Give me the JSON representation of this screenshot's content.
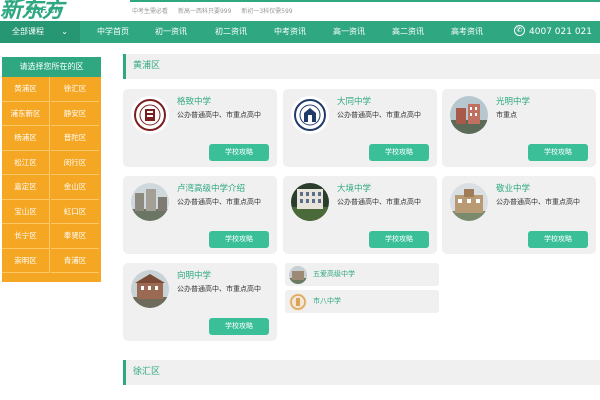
{
  "header": {
    "logo_big": "新东方",
    "logo_small": "XDF.CN",
    "hot_links": [
      "中考生需必看",
      "新高一西科只要999",
      "新初一3科仅需599"
    ]
  },
  "nav": {
    "all_courses": "全部课程",
    "items": [
      "中学首页",
      "初一资讯",
      "初二资讯",
      "中考资讯",
      "高一资讯",
      "高二资讯",
      "高考资讯"
    ],
    "phone": "4007 021 021"
  },
  "sidebar": {
    "title": "请选择您所在的区",
    "districts": [
      "黄浦区",
      "徐汇区",
      "浦东新区",
      "静安区",
      "杨浦区",
      "普陀区",
      "松江区",
      "闵行区",
      "嘉定区",
      "金山区",
      "宝山区",
      "虹口区",
      "长宁区",
      "奉贤区",
      "崇明区",
      "青浦区"
    ]
  },
  "sections": [
    {
      "district": "黄浦区",
      "schools": [
        {
          "name": "格致中学",
          "desc": "公办普通高中、市重点高中",
          "button": "学校攻略"
        },
        {
          "name": "大同中学",
          "desc": "公办普通高中、市重点高中",
          "button": "学校攻略"
        },
        {
          "name": "光明中学",
          "desc": "市重点",
          "button": "学校攻略"
        },
        {
          "name": "卢湾高级中学介绍",
          "desc": "公办普通高中、市重点高中",
          "button": "学校攻略"
        },
        {
          "name": "大境中学",
          "desc": "公办普通高中、市重点高中",
          "button": "学校攻略"
        },
        {
          "name": "敬业中学",
          "desc": "公办普通高中、市重点高中",
          "button": "学校攻略"
        },
        {
          "name": "向明中学",
          "desc": "公办普通高中、市重点高中",
          "button": "学校攻略"
        }
      ],
      "mini_schools": [
        "五爱高级中学",
        "市八中学"
      ]
    },
    {
      "district": "徐汇区"
    }
  ],
  "colors": {
    "accent": "#2fa882",
    "button": "#3bbf99",
    "sidebar": "#f5a623"
  }
}
